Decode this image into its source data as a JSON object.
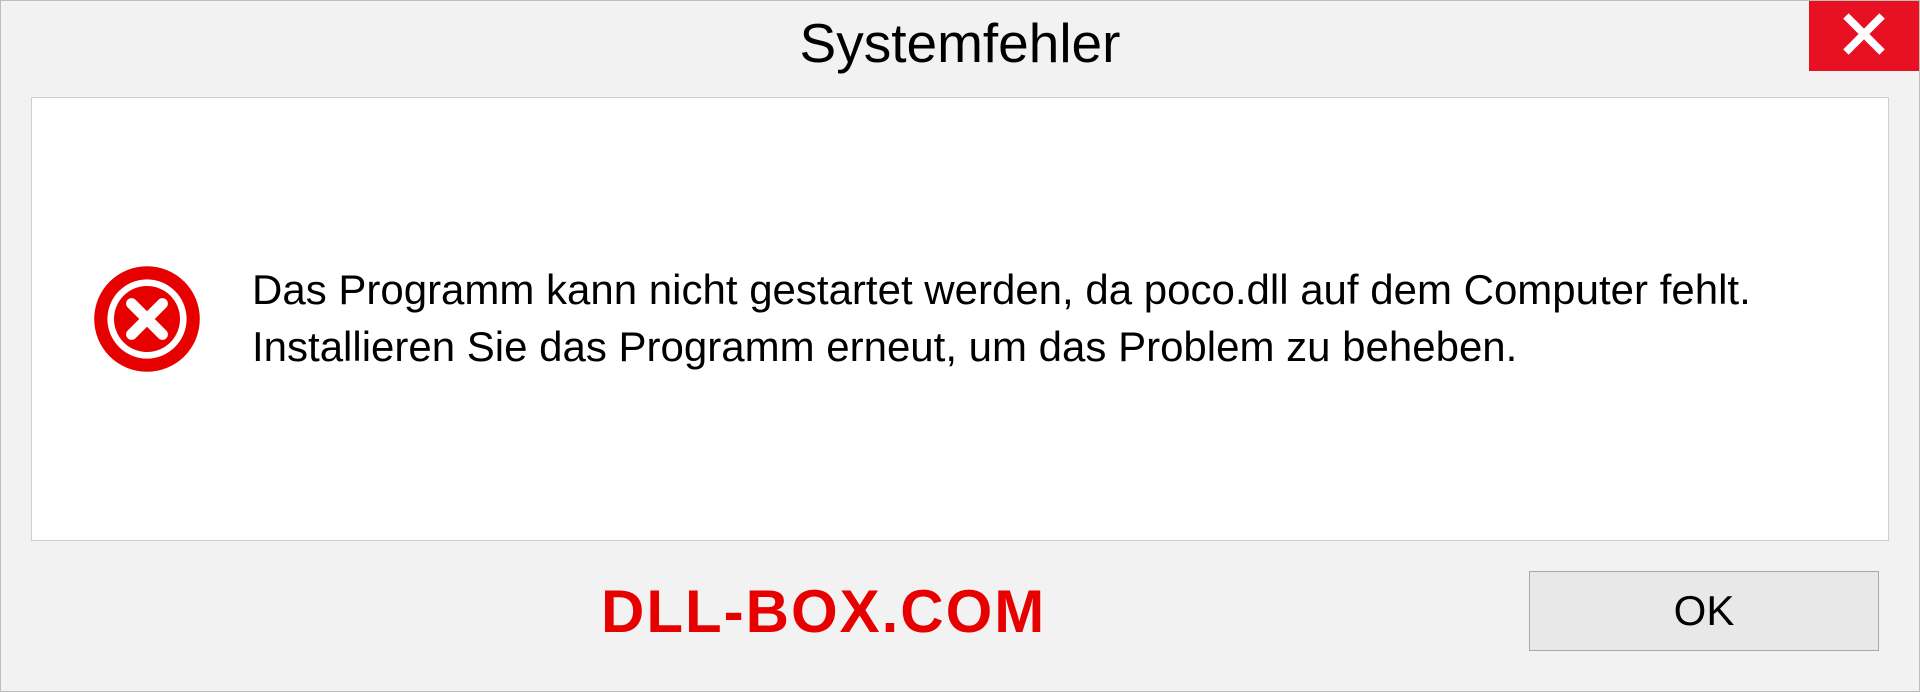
{
  "dialog": {
    "title": "Systemfehler",
    "message": "Das Programm kann nicht gestartet werden, da poco.dll auf dem Computer fehlt. Installieren Sie das Programm erneut, um das Problem zu beheben.",
    "ok_label": "OK"
  },
  "watermark": "DLL-BOX.COM",
  "colors": {
    "close_bg": "#e81123",
    "error_icon": "#e60000",
    "panel_bg": "#f2f2f2",
    "watermark": "#e60000"
  }
}
